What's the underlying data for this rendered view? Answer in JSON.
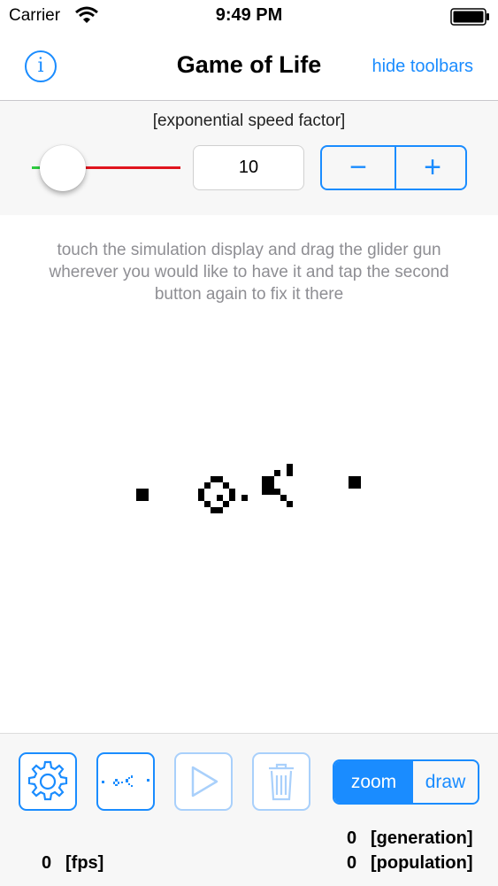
{
  "status_bar": {
    "carrier": "Carrier",
    "time": "9:49 PM"
  },
  "nav": {
    "title": "Game of Life",
    "info_icon": "i",
    "hide_toolbars_label": "hide toolbars"
  },
  "speed": {
    "label": "[exponential speed factor]",
    "value": "10",
    "slider_fraction": 0.1,
    "minus": "−",
    "plus": "+"
  },
  "hint": "touch the simulation display and drag the glider gun wherever you would like to have it and tap the second button again to fix it there",
  "toolbar": {
    "buttons": [
      "settings-gear-icon",
      "glider-gun-icon",
      "play-icon",
      "trash-icon"
    ],
    "segment": {
      "zoom": "zoom",
      "draw": "draw",
      "selected": "zoom"
    }
  },
  "stats": {
    "generation_value": "0",
    "generation_label": "[generation]",
    "population_value": "0",
    "population_label": "[population]",
    "fps_value": "0",
    "fps_label": "[fps]"
  },
  "colors": {
    "accent": "#1a8cff",
    "slider_min": "#2ecc40",
    "slider_max": "#e0141e"
  }
}
